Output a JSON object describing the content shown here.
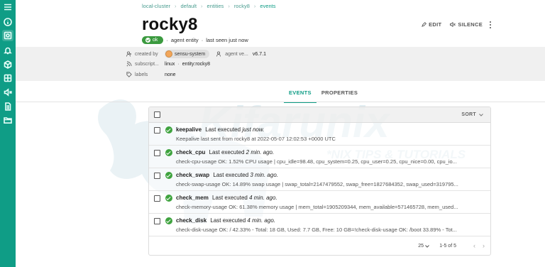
{
  "breadcrumb": [
    "local-cluster",
    "default",
    "entities",
    "rocky8",
    "events"
  ],
  "entity": {
    "name": "rocky8",
    "status": "ok",
    "subtitle_type": "agent entity",
    "subtitle_seen": "last seen just now"
  },
  "toolbar": {
    "edit_label": "EDIT",
    "silence_label": "SILENCE"
  },
  "meta": {
    "created_by_label": "created by",
    "created_by_value": "sensu-system",
    "agent_version_label": "agent ve...",
    "agent_version_value": "v6.7.1",
    "subscriptions_label": "subscript...",
    "subscriptions": [
      "linux",
      "entity:rocky8"
    ],
    "labels_label": "labels",
    "labels_value": "none"
  },
  "tabs": [
    {
      "label": "EVENTS",
      "active": true
    },
    {
      "label": "PROPERTIES",
      "active": false
    }
  ],
  "events_list": {
    "sort_label": "SORT",
    "rows": [
      {
        "check": "keepalive",
        "executed_prefix": "Last executed",
        "executed_when": "just now.",
        "output": "Keepalive last sent from rocky8 at 2022-05-07 12:02:53 +0000 UTC"
      },
      {
        "check": "check_cpu",
        "executed_prefix": "Last executed",
        "executed_when": "2 min. ago.",
        "output": "check-cpu-usage OK: 1.52% CPU usage | cpu_idle=98.48, cpu_system=0.25, cpu_user=0.25, cpu_nice=0.00, cpu_io..."
      },
      {
        "check": "check_swap",
        "executed_prefix": "Last executed",
        "executed_when": "3 min. ago.",
        "output": "check-swap-usage OK: 14.89% swap usage | swap_total=2147479552, swap_free=1827684352, swap_used=319795..."
      },
      {
        "check": "check_mem",
        "executed_prefix": "Last executed",
        "executed_when": "4 min. ago.",
        "output": "check-memory-usage OK: 61.38% memory usage | mem_total=1905209344, mem_available=571465728, mem_used..."
      },
      {
        "check": "check_disk",
        "executed_prefix": "Last executed",
        "executed_when": "4 min. ago.",
        "output": "check-disk-usage OK: / 42.33% - Total: 18 GB, Used: 7.7 GB, Free: 10 GB=!check-disk-usage OK: /boot 33.89% - Tot..."
      }
    ],
    "per_page": "25",
    "range": "1-5 of 5"
  },
  "watermark": {
    "brand": "Kifarunix",
    "tagline": "*NIX TIPS & TUTORIALS"
  },
  "colors": {
    "accent": "#0f9d86",
    "ok": "#3fa33f",
    "meta_bg": "#f0f0f0"
  },
  "rail_icons": [
    "menu-icon",
    "info-icon",
    "dashboard-icon",
    "bell-icon",
    "box-icon",
    "entities-icon",
    "mute-icon",
    "file-icon",
    "folder-icon"
  ]
}
